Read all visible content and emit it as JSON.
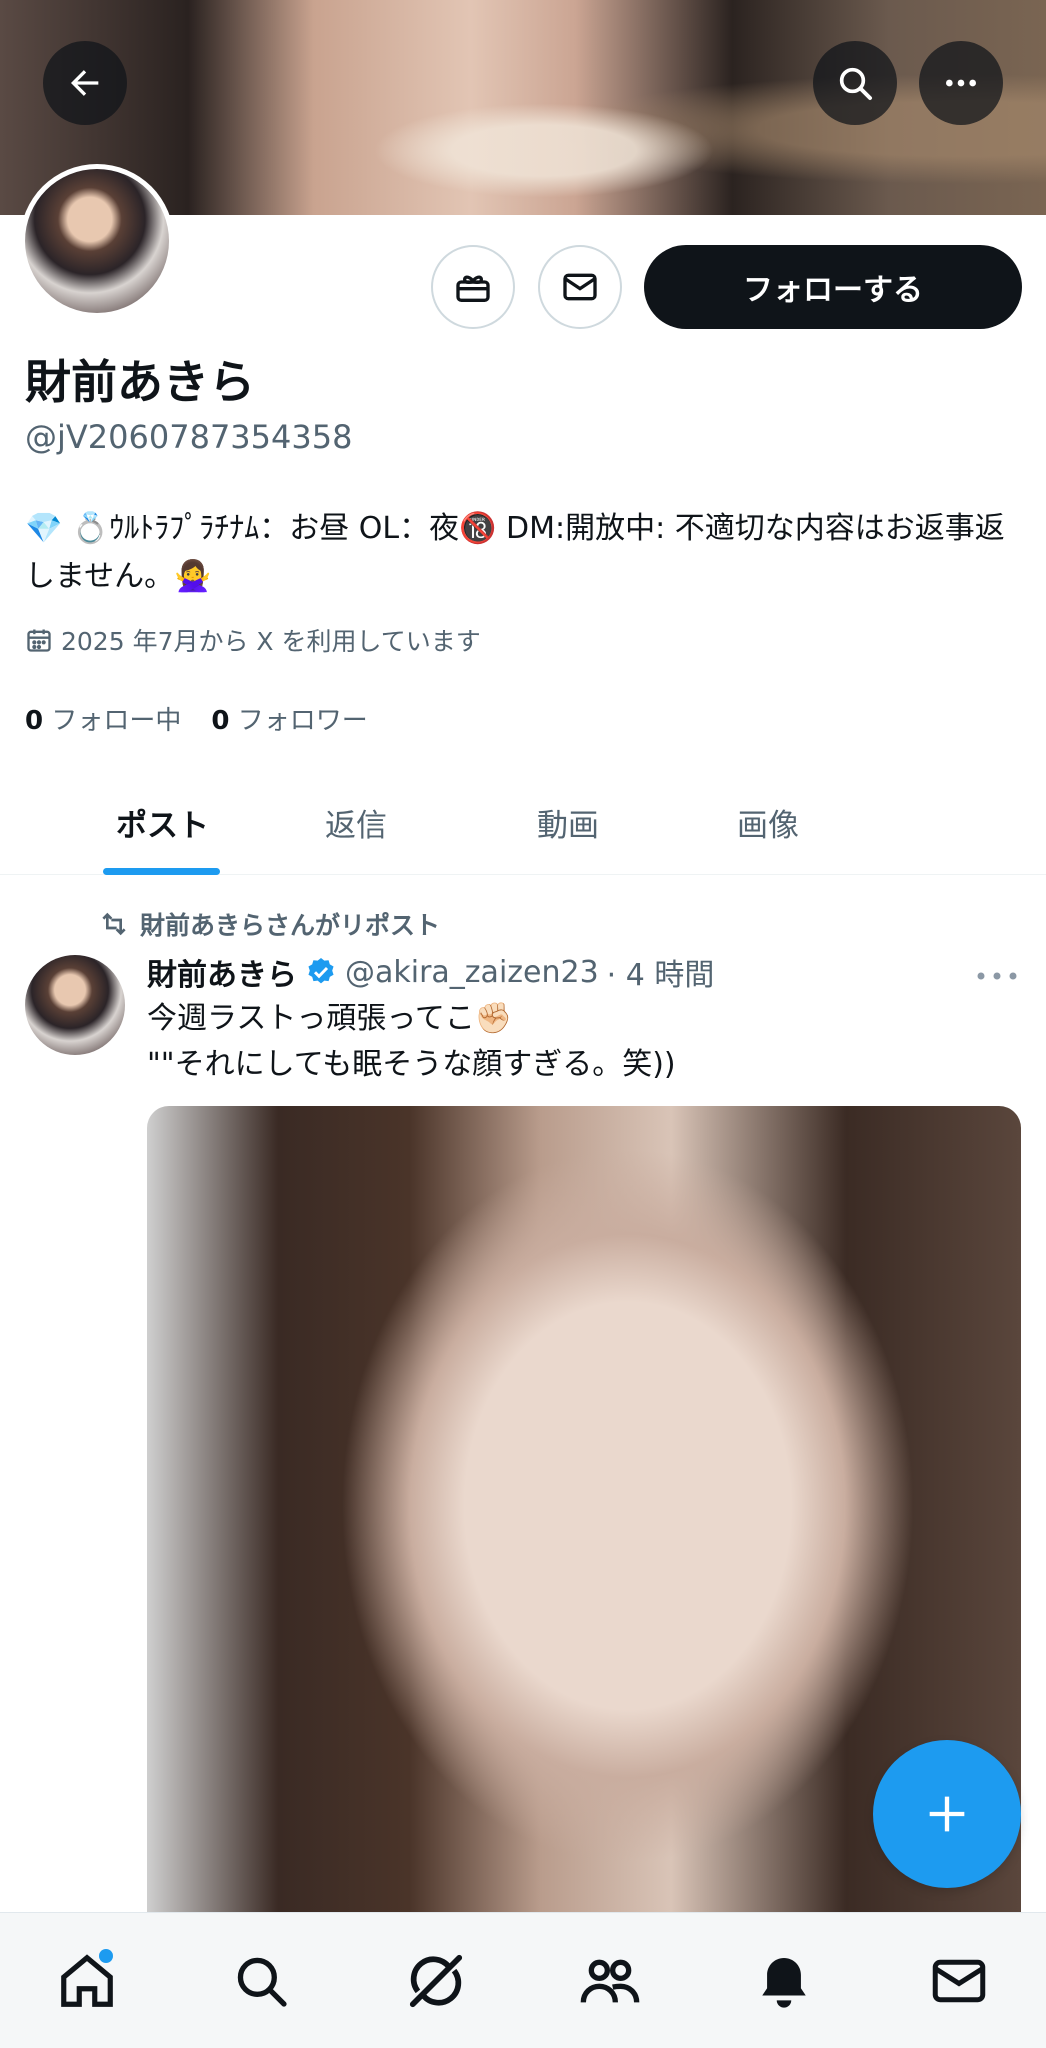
{
  "profile": {
    "name": "財前あきら",
    "handle": "@jV2060787354358",
    "bio": "💎 💍ｳﾙﾄﾗﾌﾟﾗﾁﾅﾑ：お昼 OL：夜🔞 DM:開放中: 不適切な内容はお返事返しません。🙅‍♀️",
    "joined": "2025 年7月から X を利用しています",
    "following_count": "0",
    "following_label": "フォロー中",
    "followers_count": "0",
    "followers_label": "フォロワー",
    "follow_button": "フォローする"
  },
  "tabs": [
    {
      "label": "ポスト",
      "active": true
    },
    {
      "label": "返信"
    },
    {
      "label": "動画"
    },
    {
      "label": "画像"
    }
  ],
  "tweet": {
    "repost_text": "財前あきらさんがリポスト",
    "author_name": "財前あきら",
    "author_handle": "@akira_zaizen23",
    "time": "· 4 時間",
    "text_line1": "今週ラストっ頑張ってこ✊🏻",
    "text_line2": "\"\"それにしても眠そうな顔すぎる。笑))"
  },
  "colors": {
    "accent": "#1d9bf0",
    "text": "#0f1419",
    "muted": "#536471"
  },
  "icons": {
    "back": "arrow-left-icon",
    "search": "search-icon",
    "more": "more-icon",
    "gift": "gift-icon",
    "message": "mail-icon",
    "calendar": "calendar-icon",
    "repost": "repost-icon",
    "verified": "verified-badge-icon",
    "compose": "plus-icon",
    "nav": [
      "home-icon",
      "search-icon",
      "grok-icon",
      "communities-icon",
      "notifications-icon",
      "messages-icon"
    ]
  }
}
